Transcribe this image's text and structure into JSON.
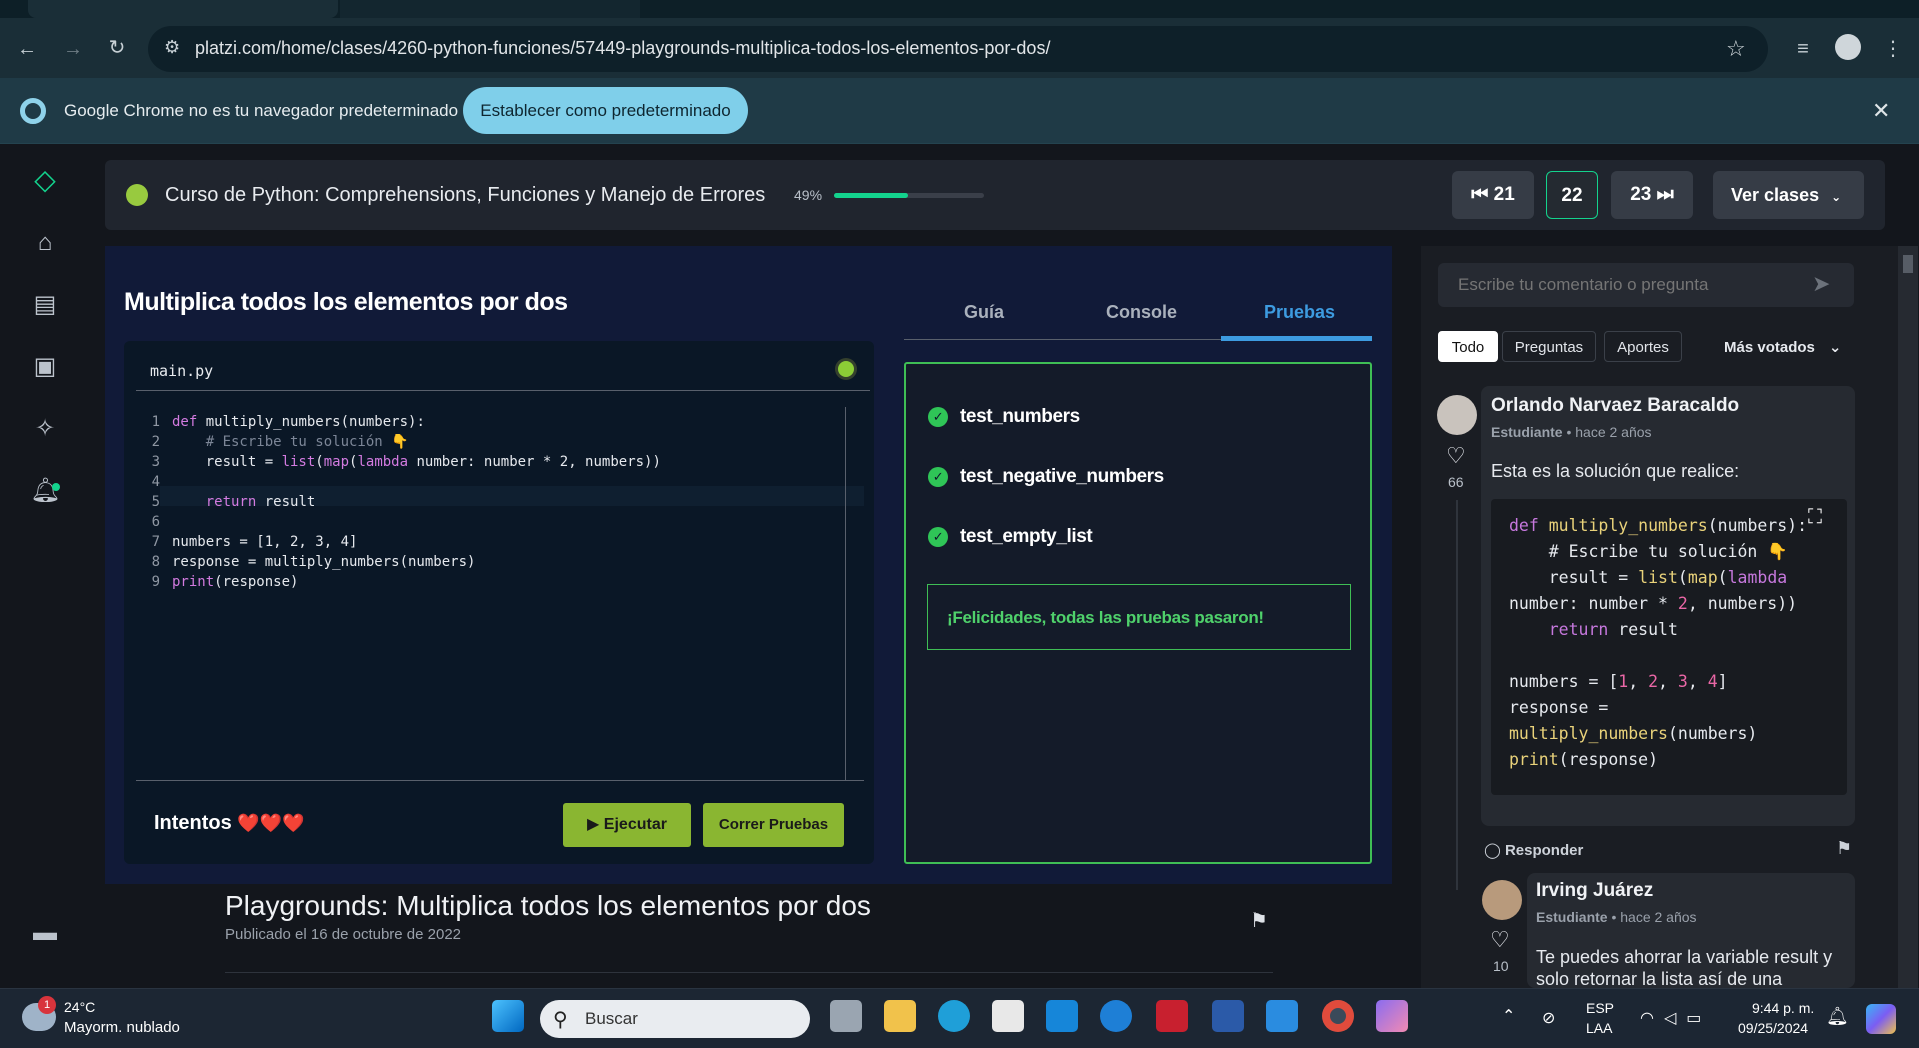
{
  "browser": {
    "url": "platzi.com/home/clases/4260-python-funciones/57449-playgrounds-multiplica-todos-los-elementos-por-dos/",
    "infobar_text": "Google Chrome no es tu navegador predeterminado",
    "infobar_button": "Establecer como predeterminado"
  },
  "course": {
    "title": "Curso de Python: Comprehensions, Funciones y Manejo de Errores",
    "progress_label": "49%",
    "progress": 0.49,
    "prev": "21",
    "current": "22",
    "next": "23",
    "ver_clases": "Ver clases"
  },
  "playground": {
    "title": "Multiplica todos los elementos por dos",
    "file": "main.py",
    "line_numbers": [
      "1",
      "2",
      "3",
      "4",
      "5",
      "6",
      "7",
      "8",
      "9"
    ],
    "code": [
      "def multiply_numbers(numbers):",
      "    # Escribe tu solución 👇",
      "    result = list(map(lambda number: number * 2, numbers))",
      "",
      "    return result",
      "",
      "numbers = [1, 2, 3, 4]",
      "response = multiply_numbers(numbers)",
      "print(response)"
    ],
    "intentos": "Intentos",
    "hearts": "❤️❤️❤️",
    "run": "Ejecutar",
    "tests_button": "Correr Pruebas",
    "tabs": [
      "Guía",
      "Console",
      "Pruebas"
    ],
    "tests": [
      "test_numbers",
      "test_negative_numbers",
      "test_empty_list"
    ],
    "success": "¡Felicidades, todas las pruebas pasaron!"
  },
  "lesson": {
    "title": "Playgrounds: Multiplica todos los elementos por dos",
    "date": "Publicado el 16 de octubre de 2022"
  },
  "comments": {
    "placeholder": "Escribe tu comentario o pregunta",
    "filters": [
      "Todo",
      "Preguntas",
      "Aportes"
    ],
    "sort": "Más votados",
    "items": [
      {
        "name": "Orlando Narvaez Baracaldo",
        "role": "Estudiante",
        "time": "• hace 2 años",
        "likes": "66",
        "text": "Esta es la solución que realice:",
        "code": [
          "def multiply_numbers(numbers):",
          "    # Escribe tu solución 👇",
          "    result = list(map(lambda",
          "number: number * 2, numbers))",
          "    return result",
          "",
          "numbers = [1, 2, 3, 4]",
          "response =",
          "multiply_numbers(numbers)",
          "print(response)"
        ]
      },
      {
        "name": "Irving Juárez",
        "role": "Estudiante",
        "time": "• hace 2 años",
        "likes": "10",
        "text": "Te puedes ahorrar la variable result y solo retornar la lista así de una"
      }
    ],
    "reply": "Responder"
  },
  "taskbar": {
    "temp": "24°C",
    "weather": "Mayorm. nublado",
    "badge": "1",
    "search": "Buscar",
    "lang1": "ESP",
    "lang2": "LAA",
    "time": "9:44 p. m.",
    "date": "09/25/2024"
  }
}
